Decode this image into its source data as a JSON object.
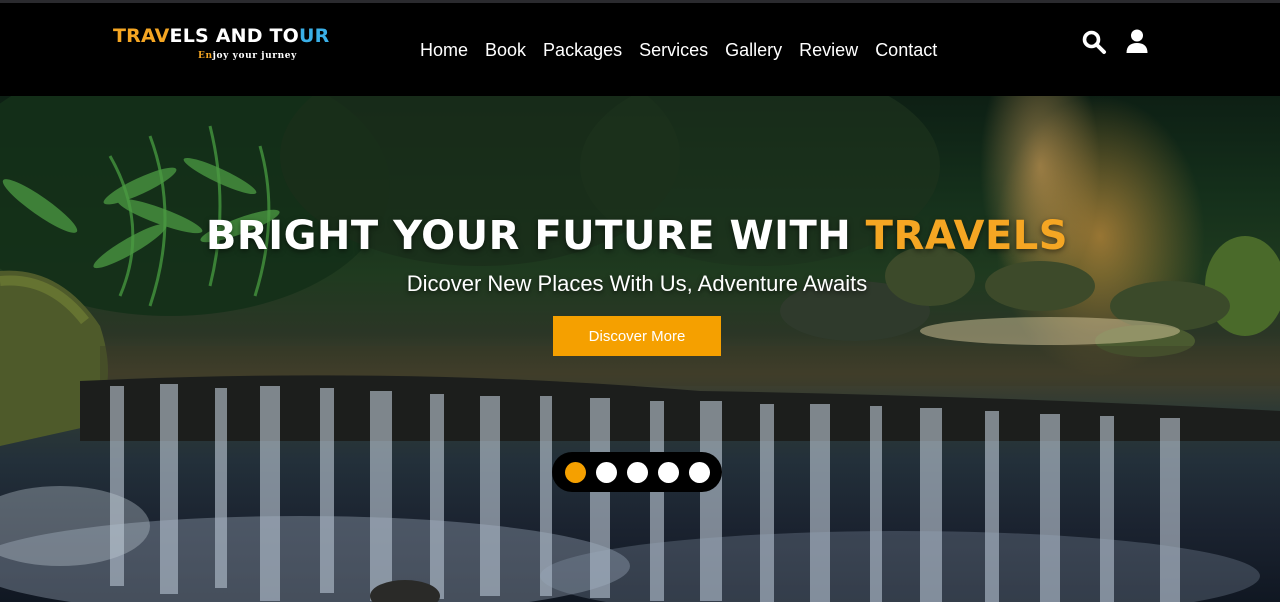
{
  "brand": {
    "title_part1": "TRAV",
    "title_part2": "ELS AND TO",
    "title_part3": "UR",
    "tagline_part1": "En",
    "tagline_part2": "joy your jurney"
  },
  "nav": {
    "items": [
      "Home",
      "Book",
      "Packages",
      "Services",
      "Gallery",
      "Review",
      "Contact"
    ]
  },
  "icons": {
    "search": "search-icon",
    "user": "user-icon"
  },
  "hero": {
    "title_main": "BRIGHT YOUR FUTURE WITH ",
    "title_accent": "TRAVELS",
    "subtitle": "Dicover New Places With Us, Adventure Awaits",
    "cta_label": "Discover More"
  },
  "slider": {
    "count": 5,
    "active_index": 0
  },
  "colors": {
    "accent": "#f5a000",
    "header_bg": "#000000",
    "logo_blue": "#3ab0e8"
  }
}
